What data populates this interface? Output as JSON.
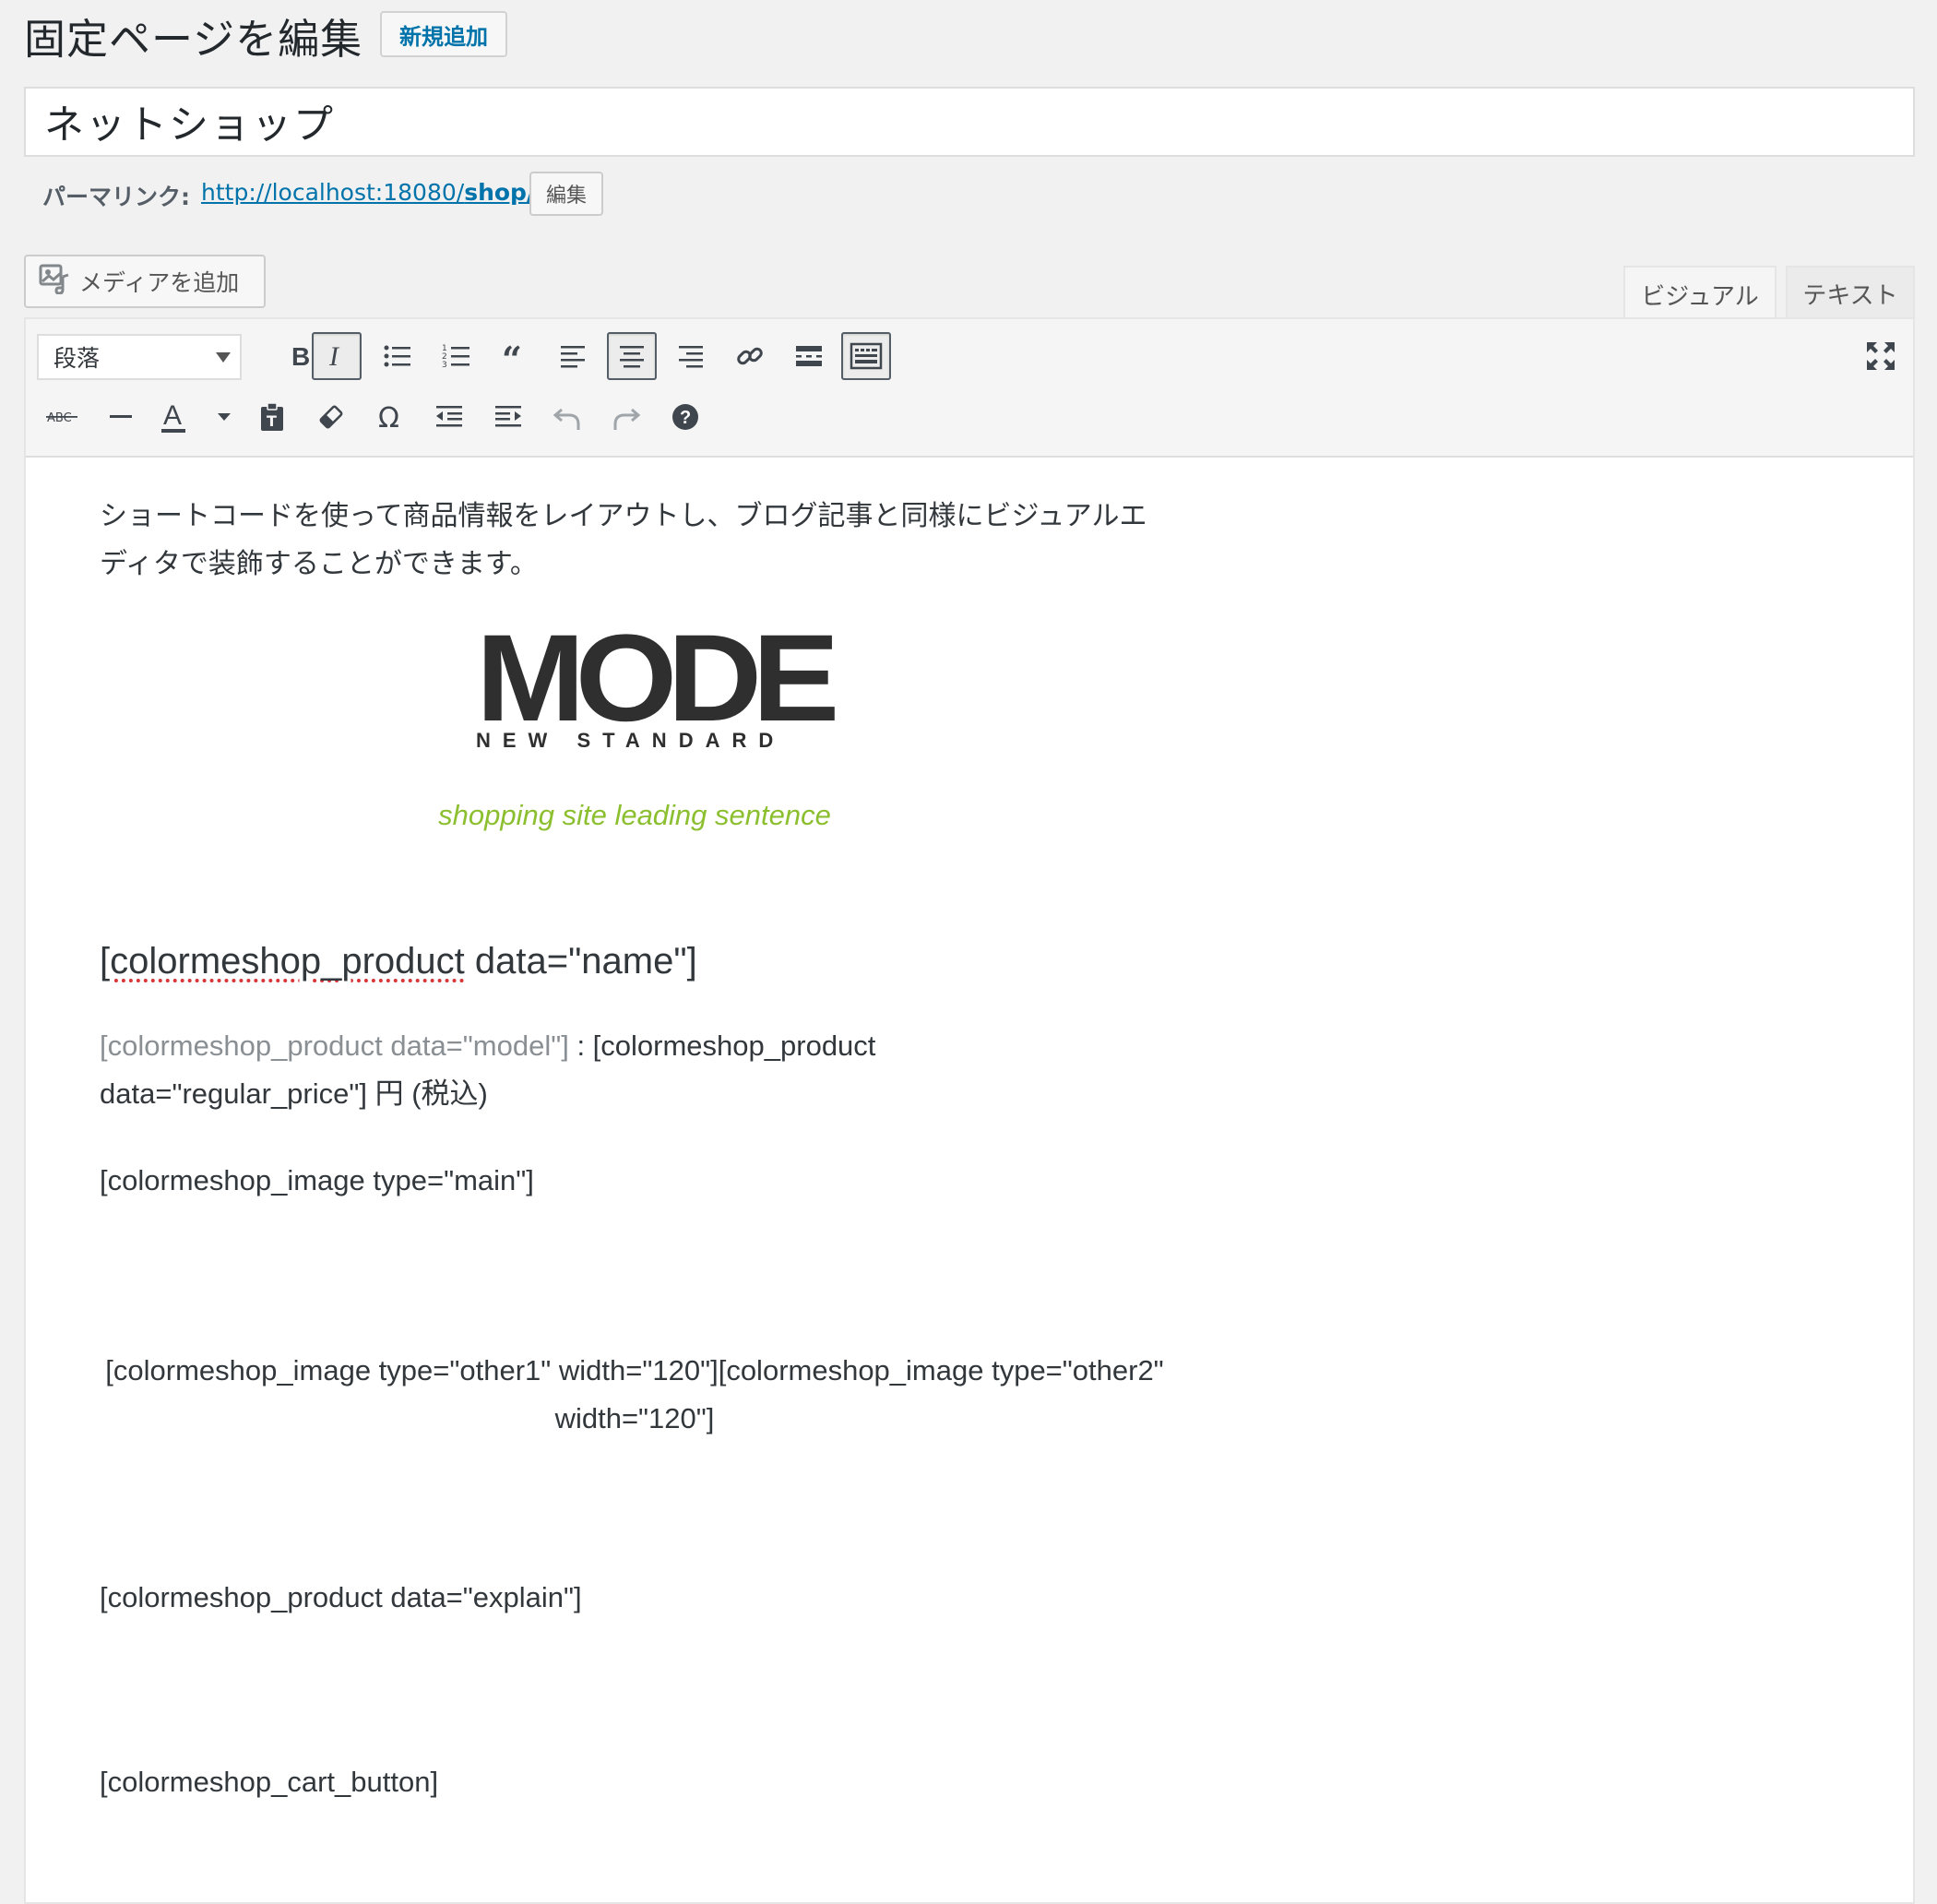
{
  "header": {
    "title": "固定ページを編集",
    "add_new_label": "新規追加"
  },
  "post": {
    "title": "ネットショップ",
    "permalink_label": "パーマリンク:",
    "permalink_base": "http://localhost:18080/",
    "permalink_slug": "shop/",
    "edit_slug_label": "編集"
  },
  "media": {
    "add_media_label": "メディアを追加"
  },
  "tabs": {
    "visual": "ビジュアル",
    "text": "テキスト",
    "active": "visual"
  },
  "toolbar": {
    "format_value": "段落",
    "row1_icons": [
      "bold-icon",
      "italic-icon",
      "bulleted-list-icon",
      "numbered-list-icon",
      "blockquote-icon",
      "align-left-icon",
      "align-center-icon",
      "align-right-icon",
      "link-icon",
      "read-more-icon",
      "toolbar-toggle-icon"
    ],
    "row2_icons": [
      "strikethrough-icon",
      "horizontal-line-icon",
      "text-color-icon",
      "paste-as-text-icon",
      "clear-formatting-icon",
      "special-character-icon",
      "outdent-icon",
      "indent-icon",
      "undo-icon",
      "redo-icon",
      "help-icon"
    ],
    "fullscreen_icon": "fullscreen-icon"
  },
  "content": {
    "intro": "ショートコードを使って商品情報をレイアウトし、ブログ記事と同様にビジュアルエディタで装飾することができます。",
    "logo_main": "MODE",
    "logo_sub": "NEW STANDARD",
    "lead": "shopping site leading sentence",
    "sc_name_prefix": "[colormeshop_product",
    "sc_name_suffix": " data=\"name\"]",
    "sc_model": "[colormeshop_product data=\"model\"]",
    "sc_price": " : [colormeshop_product data=\"regular_price\"] 円 (税込)",
    "sc_main_image": "[colormeshop_image type=\"main\"]",
    "sc_other_images": "[colormeshop_image type=\"other1\" width=\"120\"][colormeshop_image type=\"other2\" width=\"120\"]",
    "sc_explain": "[colormeshop_product data=\"explain\"]",
    "sc_cart": "[colormeshop_cart_button]"
  },
  "colors": {
    "link": "#0073aa",
    "lead_green": "#8cbf2f",
    "model_gray": "#8a8f94"
  }
}
